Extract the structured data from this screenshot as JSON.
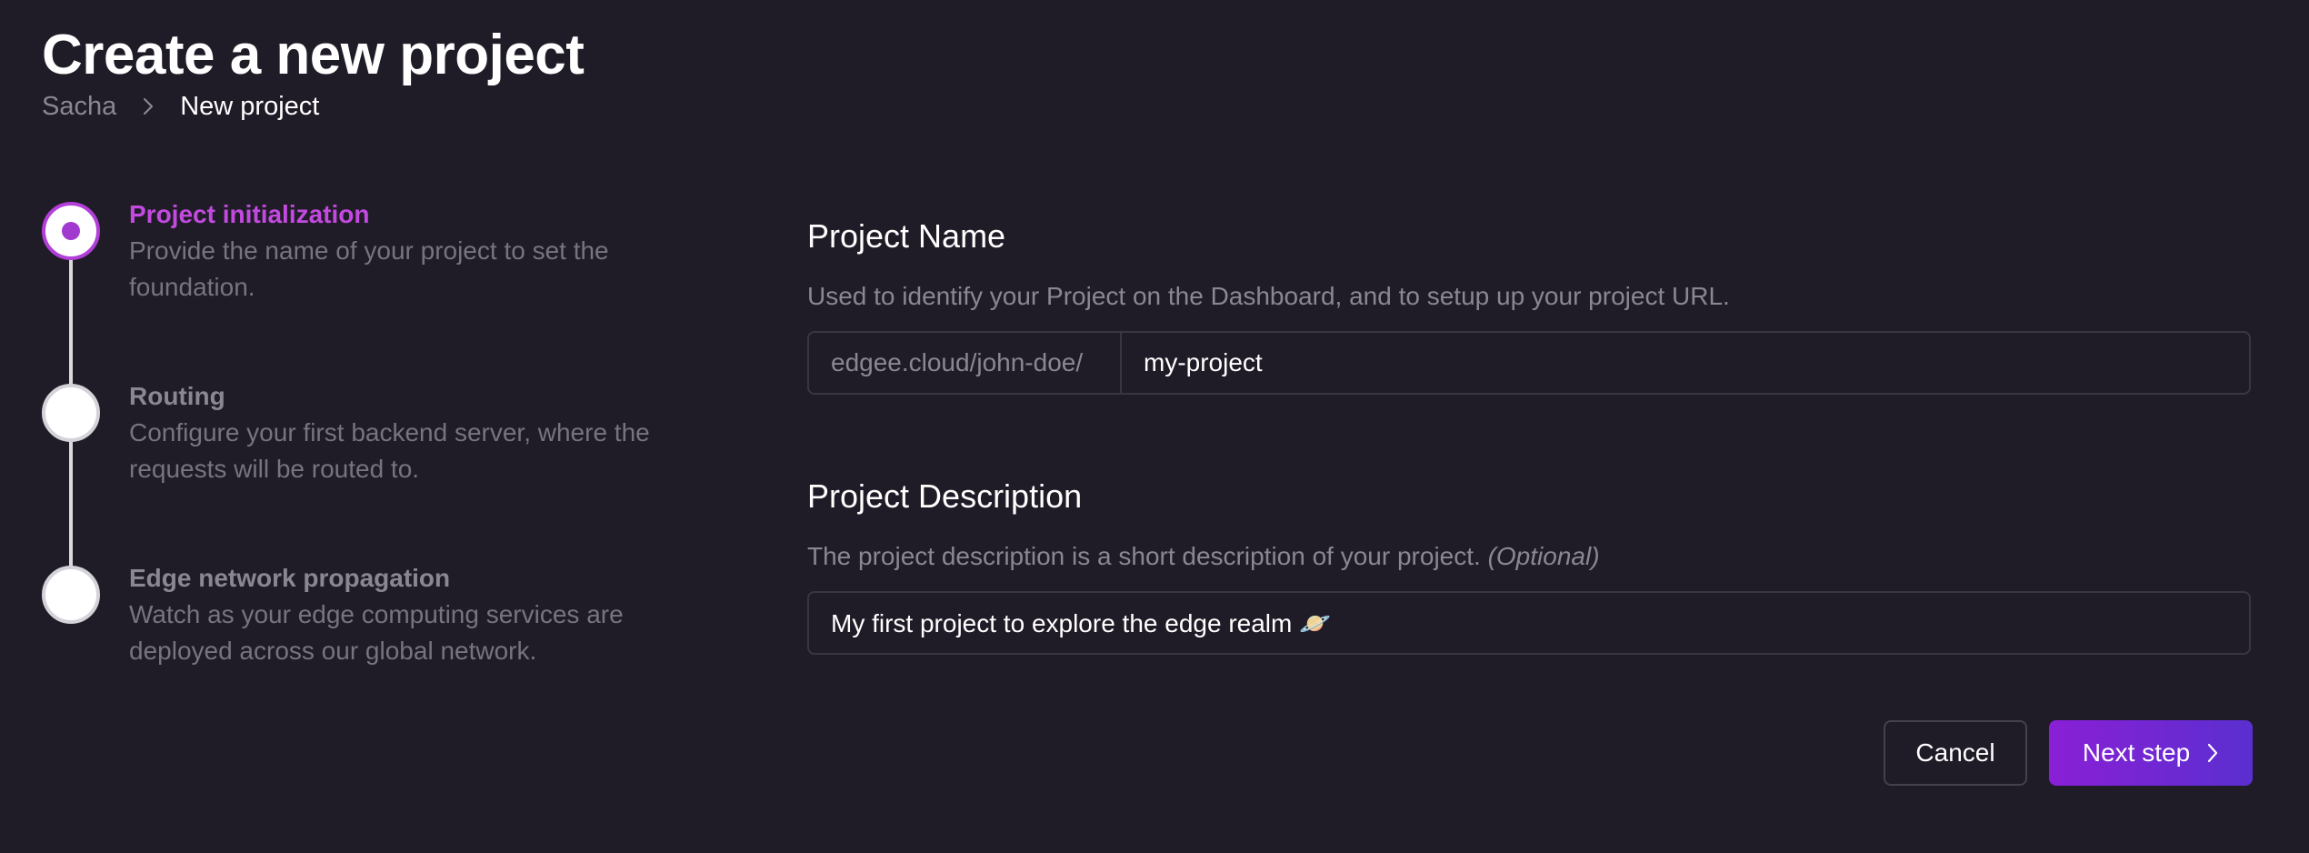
{
  "header": {
    "title": "Create a new project",
    "breadcrumb": {
      "root": "Sacha",
      "current": "New project"
    }
  },
  "stepper": {
    "steps": [
      {
        "title": "Project initialization",
        "desc_line1": "Provide the name of your project to set the",
        "desc_line2": "foundation.",
        "state": "active"
      },
      {
        "title": "Routing",
        "desc_line1": "Configure your first backend server, where the",
        "desc_line2": "requests will be routed to.",
        "state": "pending"
      },
      {
        "title": "Edge network propagation",
        "desc_line1": "Watch as your edge computing services are",
        "desc_line2": "deployed across our global network.",
        "state": "pending"
      }
    ]
  },
  "form": {
    "name_section": {
      "title": "Project Name",
      "help": "Used to identify your Project on the Dashboard, and to setup up your project URL.",
      "url_prefix": "edgee.cloud/john-doe/",
      "value": "my-project"
    },
    "description_section": {
      "title": "Project Description",
      "help": "The project description is a short description of your project.",
      "optional_label": "(Optional)",
      "value": "My first project to explore the edge realm 🪐"
    }
  },
  "actions": {
    "cancel_label": "Cancel",
    "next_label": "Next step"
  },
  "colors": {
    "background": "#201c27",
    "accent": "#b13fd8",
    "button_gradient_start": "#8a1fd6",
    "button_gradient_end": "#5a2fd0"
  },
  "icons": {
    "breadcrumb_separator": "chevron-right-icon",
    "next_button": "chevron-right-icon"
  }
}
